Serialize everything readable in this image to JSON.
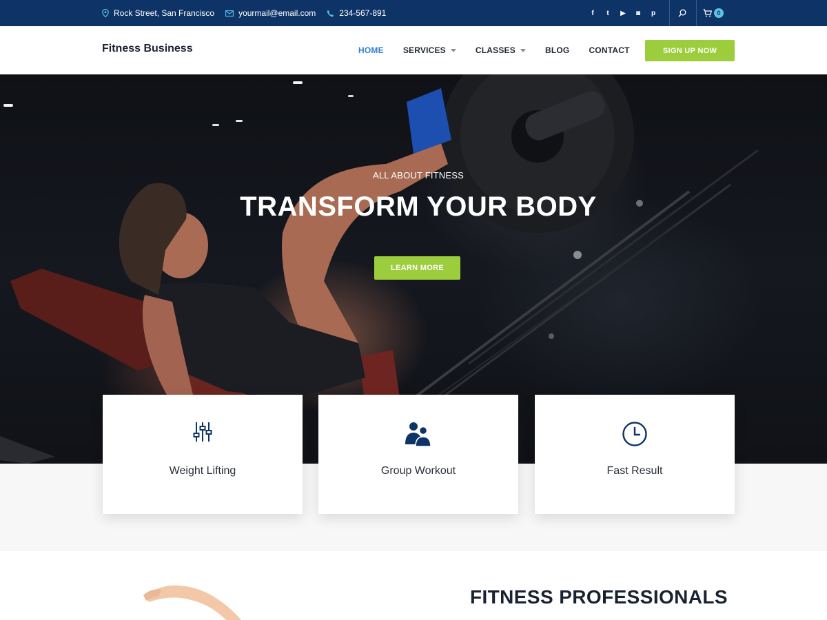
{
  "topbar": {
    "address": "Rock Street, San Francisco",
    "email": "yourmail@email.com",
    "phone": "234-567-891",
    "social_icons": [
      "facebook-icon",
      "twitter-icon",
      "youtube-icon",
      "instagram-icon",
      "pinterest-icon"
    ],
    "social_glyphs": [
      "f",
      "t",
      "▶",
      "◙",
      "p"
    ],
    "cart_count": "0"
  },
  "header": {
    "brand": "Fitness Business",
    "nav": [
      {
        "label": "HOME",
        "active": true,
        "dropdown": false
      },
      {
        "label": "SERVICES",
        "active": false,
        "dropdown": true
      },
      {
        "label": "CLASSES",
        "active": false,
        "dropdown": true
      },
      {
        "label": "BLOG",
        "active": false,
        "dropdown": false
      },
      {
        "label": "CONTACT",
        "active": false,
        "dropdown": false
      }
    ],
    "cta": "SIGN UP NOW"
  },
  "hero": {
    "kicker": "ALL ABOUT FITNESS",
    "headline": "TRANSFORM YOUR BODY",
    "button": "LEARN MORE"
  },
  "features": [
    {
      "label": "Weight Lifting",
      "icon": "sliders-icon"
    },
    {
      "label": "Group Workout",
      "icon": "users-icon"
    },
    {
      "label": "Fast Result",
      "icon": "clock-icon"
    }
  ],
  "about": {
    "title": "FITNESS PROFESSIONALS"
  },
  "colors": {
    "topbar": "#0e3467",
    "accent_green": "#9ccd3c",
    "nav_active": "#2f80d1",
    "icon_navy": "#0e3467"
  }
}
